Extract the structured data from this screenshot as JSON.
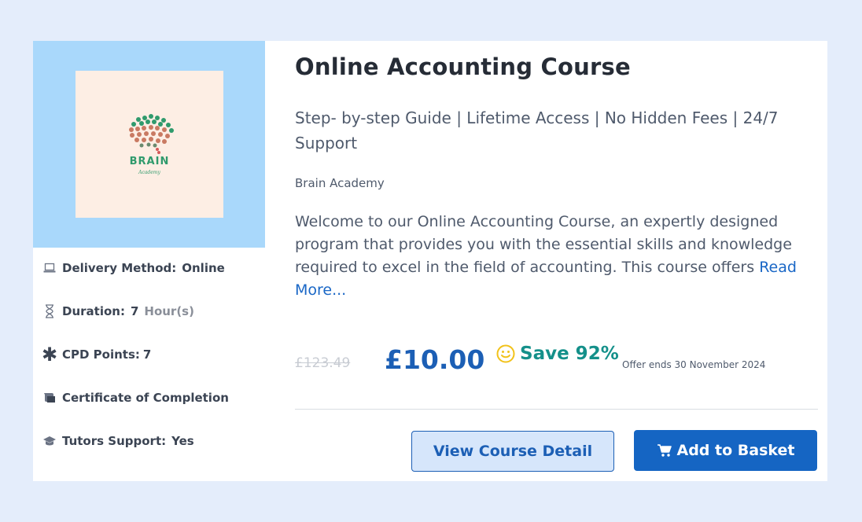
{
  "course": {
    "title": "Online Accounting Course",
    "subtitle": "Step- by-step Guide | Lifetime Access | No Hidden Fees | 24/7 Support",
    "provider": "Brain Academy",
    "description": "Welcome to our Online Accounting Course, an expertly designed program that provides you with the essential skills and knowledge required to excel in the field of accounting. This course offers ",
    "read_more": "Read More..."
  },
  "thumbnail": {
    "brand_name": "BRAIN",
    "brand_sub": "Academy"
  },
  "features": {
    "delivery": {
      "label": "Delivery Method:",
      "value": "Online",
      "icon": "laptop-icon"
    },
    "duration": {
      "label": "Duration:",
      "value": "7",
      "unit": "Hour(s)",
      "icon": "hourglass-icon"
    },
    "cpd": {
      "label": "CPD Points:",
      "value": "7",
      "icon": "asterisk-icon"
    },
    "certificate": {
      "label": "Certificate of Completion",
      "icon": "certificate-icon"
    },
    "tutors": {
      "label": "Tutors Support:",
      "value": "Yes",
      "icon": "graduation-cap-icon"
    }
  },
  "pricing": {
    "old_price": "£123.49",
    "price": "£10.00",
    "save": "Save 92%",
    "offer": "Offer ends 30 November 2024"
  },
  "buttons": {
    "view_detail": "View Course Detail",
    "add_basket": "Add to Basket"
  },
  "colors": {
    "accent": "#1565c3",
    "save_green": "#14908a",
    "thumb_bg": "#a9d8fb",
    "page_bg": "#e4edfb"
  }
}
